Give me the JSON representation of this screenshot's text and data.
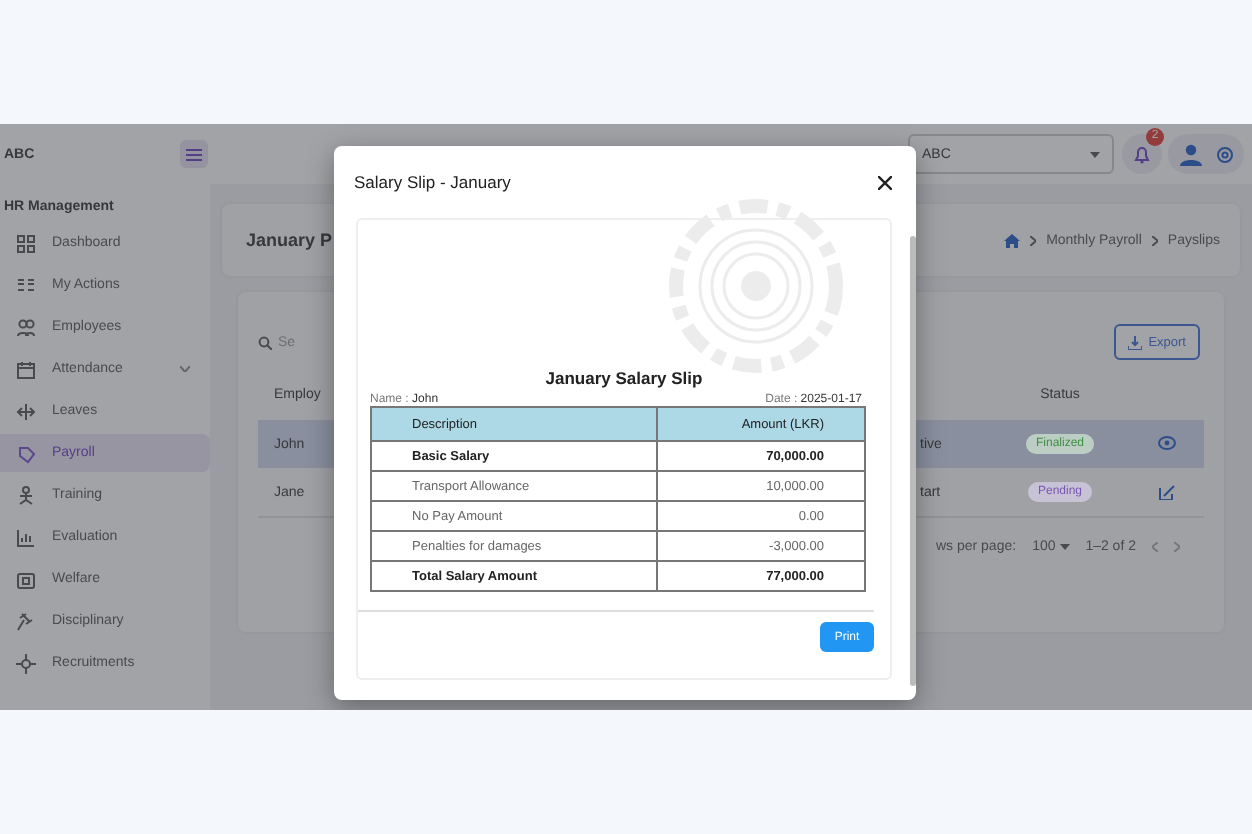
{
  "header": {
    "brand": "ABC",
    "company_select": {
      "value": "ABC"
    },
    "notification_badge": "2"
  },
  "sidebar": {
    "section": "HR Management",
    "items": [
      {
        "label": "Dashboard",
        "selected": false,
        "expandable": false
      },
      {
        "label": "My Actions",
        "selected": false,
        "expandable": false
      },
      {
        "label": "Employees",
        "selected": false,
        "expandable": false
      },
      {
        "label": "Attendance",
        "selected": false,
        "expandable": true
      },
      {
        "label": "Leaves",
        "selected": false,
        "expandable": false
      },
      {
        "label": "Payroll",
        "selected": true,
        "expandable": false
      },
      {
        "label": "Training",
        "selected": false,
        "expandable": false
      },
      {
        "label": "Evaluation",
        "selected": false,
        "expandable": false
      },
      {
        "label": "Welfare",
        "selected": false,
        "expandable": false
      },
      {
        "label": "Disciplinary",
        "selected": false,
        "expandable": false
      },
      {
        "label": "Recruitments",
        "selected": false,
        "expandable": false
      }
    ]
  },
  "page": {
    "title": "January P",
    "breadcrumb": [
      "Monthly Payroll",
      "Payslips"
    ]
  },
  "table": {
    "search_placeholder": "Se",
    "export_label": "Export",
    "columns": [
      "Employ",
      "Status"
    ],
    "rows": [
      {
        "employee": "John",
        "column_3": "tive",
        "status": "Finalized",
        "color": "#3f8f46",
        "kind": "view",
        "selected": true
      },
      {
        "employee": "Jane",
        "column_3": "tart",
        "status": "Pending",
        "color": "#7a56b0",
        "kind": "edit",
        "selected": false
      }
    ]
  },
  "pagination": {
    "rows_per_page_label": "ws per page:",
    "rows_per_page": "100",
    "range": "1–2 of 2"
  },
  "modal": {
    "title": "Salary Slip - January",
    "slip": {
      "heading": "January Salary Slip",
      "name_label": "Name :",
      "name": "John",
      "date_label": "Date :",
      "date": "2025-01-17",
      "columns": [
        "Description",
        "Amount (LKR)"
      ],
      "rows": [
        {
          "description": "Basic Salary",
          "amount": "70,000.00",
          "bold": true
        },
        {
          "description": "Transport Allowance",
          "amount": "10,000.00",
          "bold": false
        },
        {
          "description": "No Pay Amount",
          "amount": "0.00",
          "bold": false
        },
        {
          "description": "Penalties for damages",
          "amount": "-3,000.00",
          "bold": false
        },
        {
          "description": "Total Salary Amount",
          "amount": "77,000.00",
          "bold": true
        }
      ]
    },
    "print_label": "Print"
  }
}
